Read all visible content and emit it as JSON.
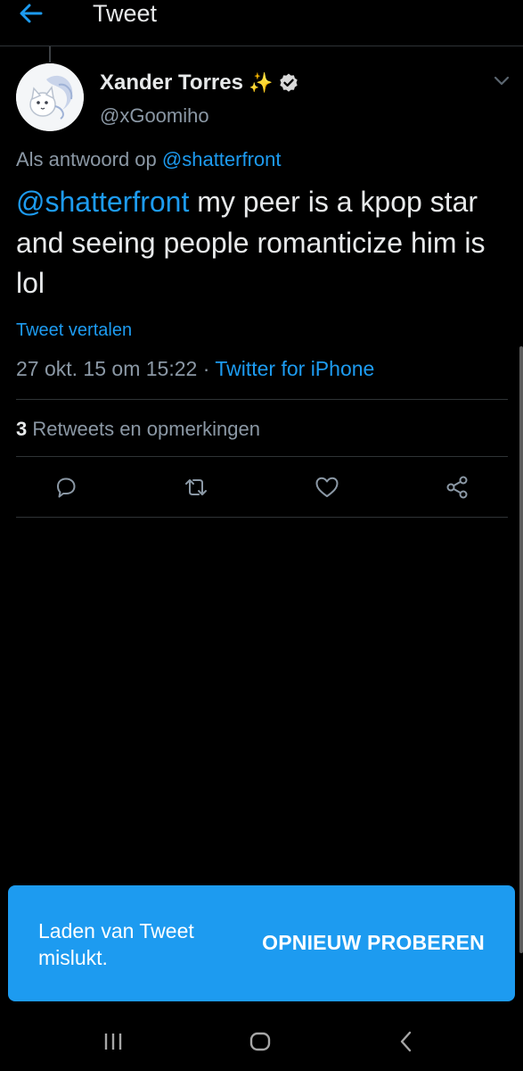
{
  "header": {
    "title": "Tweet",
    "back_icon": "arrow-left-icon"
  },
  "tweet": {
    "author_name": "Xander Torres",
    "name_emoji": "✨",
    "verified": true,
    "handle": "@xGoomiho",
    "reply_prefix": "Als antwoord op",
    "reply_to": "@shatterfront",
    "text_mention": "@shatterfront",
    "text_body": " my peer is a kpop star and seeing people romanticize him is lol",
    "translate_label": "Tweet vertalen",
    "timestamp": "27 okt. 15 om 15:22",
    "separator": " · ",
    "source": "Twitter for iPhone",
    "retweet_count": "3",
    "retweet_label": "Retweets en opmerkingen"
  },
  "actions": {
    "reply_icon": "reply-icon",
    "retweet_icon": "retweet-icon",
    "like_icon": "heart-icon",
    "share_icon": "share-icon"
  },
  "toast": {
    "message": "Laden van Tweet mislukt.",
    "action_label": "OPNIEUW PROBEREN"
  },
  "system_nav": {
    "recents_icon": "recents-icon",
    "home_icon": "home-icon",
    "back_icon": "back-icon"
  },
  "colors": {
    "accent": "#1d9bf0",
    "background": "#000000",
    "toast_background": "#1d9bf0",
    "secondary_text": "#8b98a5"
  }
}
